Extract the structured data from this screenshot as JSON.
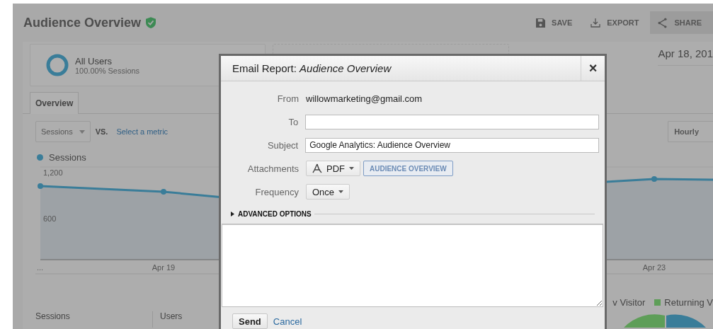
{
  "header": {
    "title": "Audience Overview",
    "actions": [
      {
        "label": "SAVE",
        "kind": "save",
        "selected": false
      },
      {
        "label": "EXPORT",
        "kind": "export",
        "selected": false
      },
      {
        "label": "SHARE",
        "kind": "share",
        "selected": true
      }
    ]
  },
  "segment": {
    "name": "All Users",
    "detail": "100.00% Sessions"
  },
  "date_range": "Apr 18, 201",
  "tabs": [
    {
      "label": "Overview",
      "selected": true
    }
  ],
  "metric": {
    "selected": "Sessions",
    "vs": "VS.",
    "link": "Select a metric"
  },
  "interval": "Hourly",
  "legend": "Sessions",
  "chart": {
    "y_labels": [
      "1,200",
      "600"
    ],
    "x_labels": [
      "...",
      "Apr 19",
      "Apr 23"
    ]
  },
  "stats": [
    {
      "label": "Sessions"
    },
    {
      "label": "Users"
    }
  ],
  "pie_legend": [
    {
      "label": "v Visitor"
    },
    {
      "label": "Returning V",
      "color": "#5e9e58"
    }
  ],
  "dialog": {
    "title": "Email Report: *Audience Overview*",
    "close": "×",
    "from": {
      "label": "From",
      "value": "willowmarketing@gmail.com"
    },
    "fields": [
      {
        "label": "To"
      },
      {
        "label": "Subject",
        "value": "Google Analytics: Audience Overview"
      }
    ],
    "attachments": {
      "label": "Attachments",
      "format": "PDF",
      "report": "AUDIENCE OVERVIEW"
    },
    "frequency": {
      "label": "Frequency",
      "value": "Once"
    },
    "advanced": {
      "label": "ADVANCED OPTIONS",
      "expanded": false
    },
    "send": "Send",
    "cancel": "Cancel"
  }
}
